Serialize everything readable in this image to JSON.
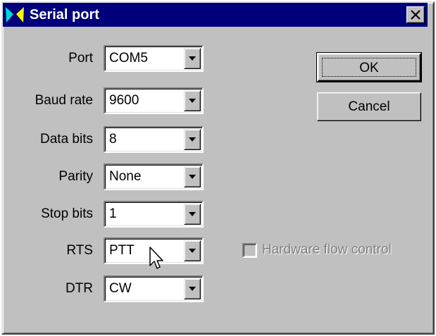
{
  "window": {
    "title": "Serial port",
    "icons": {
      "app": "butterfly-icon",
      "close": "close-icon"
    },
    "colors": {
      "titlebar": "#00007b",
      "face": "#c0c0c0"
    }
  },
  "fields": [
    {
      "label": "Port",
      "value": "COM5"
    },
    {
      "label": "Baud rate",
      "value": "9600"
    },
    {
      "label": "Data bits",
      "value": "8"
    },
    {
      "label": "Parity",
      "value": "None"
    },
    {
      "label": "Stop bits",
      "value": "1"
    },
    {
      "label": "RTS",
      "value": "PTT"
    },
    {
      "label": "DTR",
      "value": "CW"
    }
  ],
  "buttons": {
    "ok": "OK",
    "cancel": "Cancel"
  },
  "hardware_flow_control": {
    "label": "Hardware flow control",
    "checked": false,
    "enabled": false
  }
}
